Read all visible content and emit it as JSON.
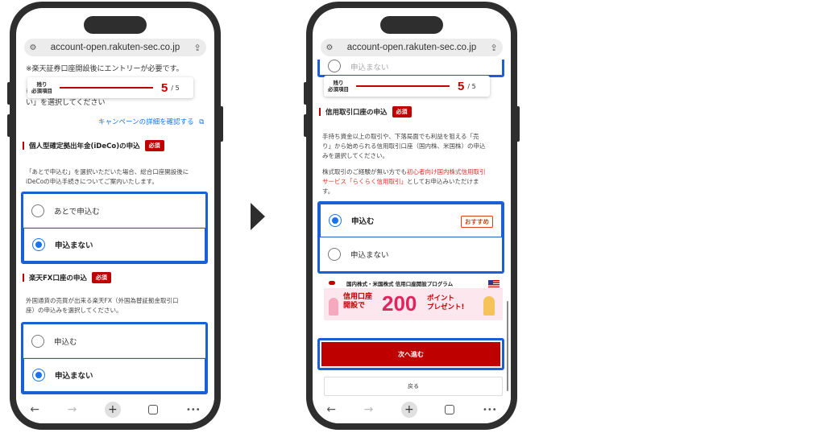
{
  "left_phone": {
    "url": "account-open.rakuten-sec.co.jp",
    "top_note": "※楽天証券口座開設後にエントリーが必要です。",
    "partial_note_mark": "※",
    "partial_line": "い」を選択してください",
    "progress": {
      "label_line1": "残り",
      "label_line2": "必須項目",
      "current": "5",
      "total": "/ 5"
    },
    "campaign_link": "キャンペーンの詳細を確認する",
    "ideco": {
      "title": "個人型確定拠出年金(iDeCo)の申込",
      "required": "必須",
      "desc_line1": "「あとで申込む」を選択いただいた場合、総合口座開設後に",
      "desc_line2": "iDeCoの申込手続きについてご案内いたします。",
      "options": [
        "あとで申込む",
        "申込まない"
      ]
    },
    "fx": {
      "title": "楽天FX口座の申込",
      "required": "必須",
      "desc_line1": "外国通貨の売買が出来る楽天FX（外国為替証拠金取引口",
      "desc_line2": "座）の申込みを選択してください。",
      "options": [
        "申込む",
        "申込まない"
      ]
    }
  },
  "right_phone": {
    "url": "account-open.rakuten-sec.co.jp",
    "progress": {
      "label_line1": "残り",
      "label_line2": "必須項目",
      "current": "5",
      "total": "/ 5"
    },
    "partial_option": "申込まない",
    "margin": {
      "title": "信用取引口座の申込",
      "required": "必須",
      "desc_line1": "手持ち資金以上の取引や、下落局面でも利益を狙える「売",
      "desc_line2": "り」から始められる信用取引口座（国内株、米国株）の申込",
      "desc_line3": "みを選択してください。",
      "desc2_line1a": "株式取引のご経験が無い方でも",
      "desc2_line1b": "初心者向け国内株式信用取引",
      "desc2_line2a": "サービス「らくらく信用取引」",
      "desc2_line2b": "としてお申込みいただけま",
      "desc2_line3": "す。",
      "options": [
        "申込む",
        "申込まない"
      ],
      "recommend": "おすすめ"
    },
    "banner": {
      "head": "国内株式・米国株式 信用口座開設プログラム",
      "t1_line1": "信用口座",
      "t1_line2": "開設で",
      "amount": "200",
      "t3_line1": "ポイント",
      "t3_line2": "プレゼント!"
    },
    "next_button": "次へ進む",
    "back_button": "戻る"
  },
  "nav": {
    "back": "←",
    "forward": "→",
    "new_tab": "+",
    "more": "•••"
  }
}
